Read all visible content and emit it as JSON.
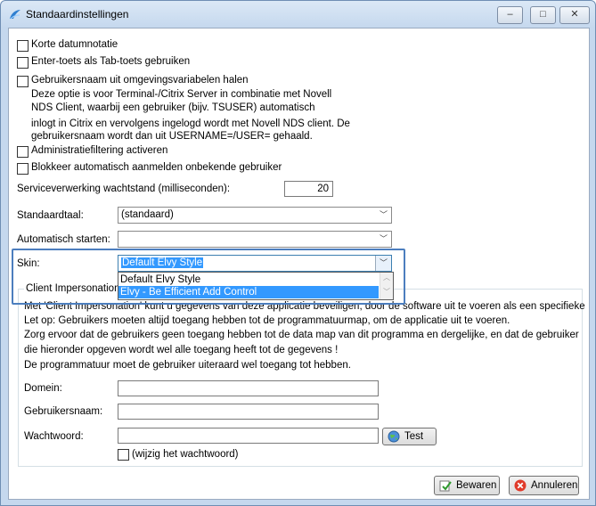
{
  "window": {
    "title": "Standaardinstellingen",
    "minimize_glyph": "–",
    "maximize_glyph": "□",
    "close_glyph": "✕"
  },
  "options": {
    "korte_datum": "Korte datumnotatie",
    "enter_tab": "Enter-toets als Tab-toets gebruiken",
    "omgeving": "Gebruikersnaam uit omgevingsvariabelen halen",
    "omgeving_note_1": "Deze optie is voor Terminal-/Citrix Server in combinatie met Novell",
    "omgeving_note_2": "NDS Client, waarbij een gebruiker (bijv. TSUSER) automatisch",
    "omgeving_note_3": "inlogt in Citrix en vervolgens ingelogd wordt met Novell NDS client. De",
    "omgeving_note_4": "gebruikersnaam wordt dan uit USERNAME=/USER= gehaald.",
    "admin_filter": "Administratiefiltering activeren",
    "blokkeer": "Blokkeer automatisch aanmelden onbekende gebruiker"
  },
  "service": {
    "label": "Serviceverwerking wachtstand (milliseconden):",
    "value": "20"
  },
  "standaardtaal": {
    "label": "Standaardtaal:",
    "value": "(standaard)"
  },
  "automatisch": {
    "label": "Automatisch starten:",
    "value": ""
  },
  "skin": {
    "label": "Skin:",
    "value": "Default Elvy Style",
    "options": [
      "Default Elvy Style",
      "Elvy - Be Efficient Add Control"
    ],
    "selected_index": 1
  },
  "client_impersonation": {
    "group_label": "Client Impersonation",
    "line_1": "Met 'Client Impersonation' kunt u gegevens van deze applicatie beveiligen, door de software uit te voeren als een specifieke",
    "line_2": "Let op: Gebruikers moeten altijd toegang hebben tot de programmatuurmap, om de applicatie uit te voeren.",
    "line_3": "Zorg ervoor dat de gebruikers geen toegang hebben tot de data map van dit programma en dergelijke, en dat de gebruiker",
    "line_4": "die hieronder opgeven wordt wel alle toegang heeft tot de gegevens !",
    "line_5": "De programmatuur moet de gebruiker uiteraard wel toegang tot hebben.",
    "domein_label": "Domein:",
    "domein_value": "",
    "gebruikersnaam_label": "Gebruikersnaam:",
    "gebruikersnaam_value": "",
    "wachtwoord_label": "Wachtwoord:",
    "wachtwoord_value": "",
    "test_label": "Test",
    "wijzig_label": "(wijzig het wachtwoord)"
  },
  "buttons": {
    "bewaren": "Bewaren",
    "annuleren": "Annuleren"
  },
  "colors": {
    "selection": "#3399ff",
    "highlight_border": "#4c7ebe"
  }
}
